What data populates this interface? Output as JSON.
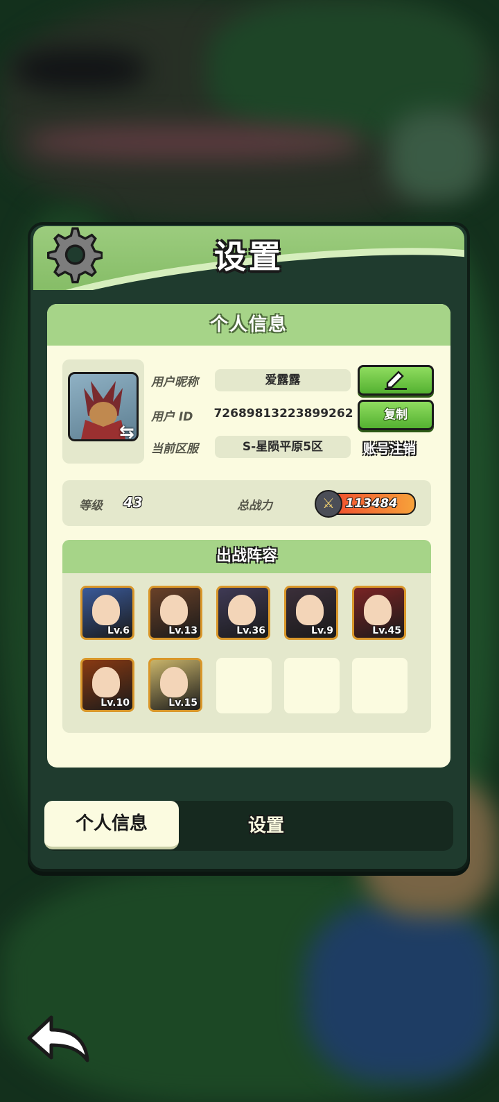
{
  "header": {
    "title": "设置"
  },
  "card": {
    "title": "个人信息",
    "profile": {
      "nickname_label": "用户昵称",
      "nickname": "爱露露",
      "id_label": "用户  ID",
      "user_id": "7268981322389926​2",
      "server_label": "当前区服",
      "server": "S-星陨平原5区",
      "copy_label": "复制",
      "cancel_label": "账号注销"
    },
    "stats": {
      "level_label": "等级",
      "level": "43",
      "power_label": "总战力",
      "power": "113484"
    },
    "team": {
      "title": "出战阵容",
      "heroes": [
        {
          "level": "Lv.6",
          "color": "#3a5a9a"
        },
        {
          "level": "Lv.13",
          "color": "#6a4128"
        },
        {
          "level": "Lv.36",
          "color": "#3f3a55"
        },
        {
          "level": "Lv.9",
          "color": "#3b2f3a"
        },
        {
          "level": "Lv.45",
          "color": "#7a2424"
        },
        {
          "level": "Lv.10",
          "color": "#8a3a12"
        },
        {
          "level": "Lv.15",
          "color": "#c9b46a"
        }
      ]
    }
  },
  "tabs": {
    "active": "个人信息",
    "other": "设置"
  },
  "colors": {
    "panel": "#1f3b2e",
    "card": "#fbfbe0",
    "accent_green": "#a6d488",
    "button_green": "#54b131"
  }
}
